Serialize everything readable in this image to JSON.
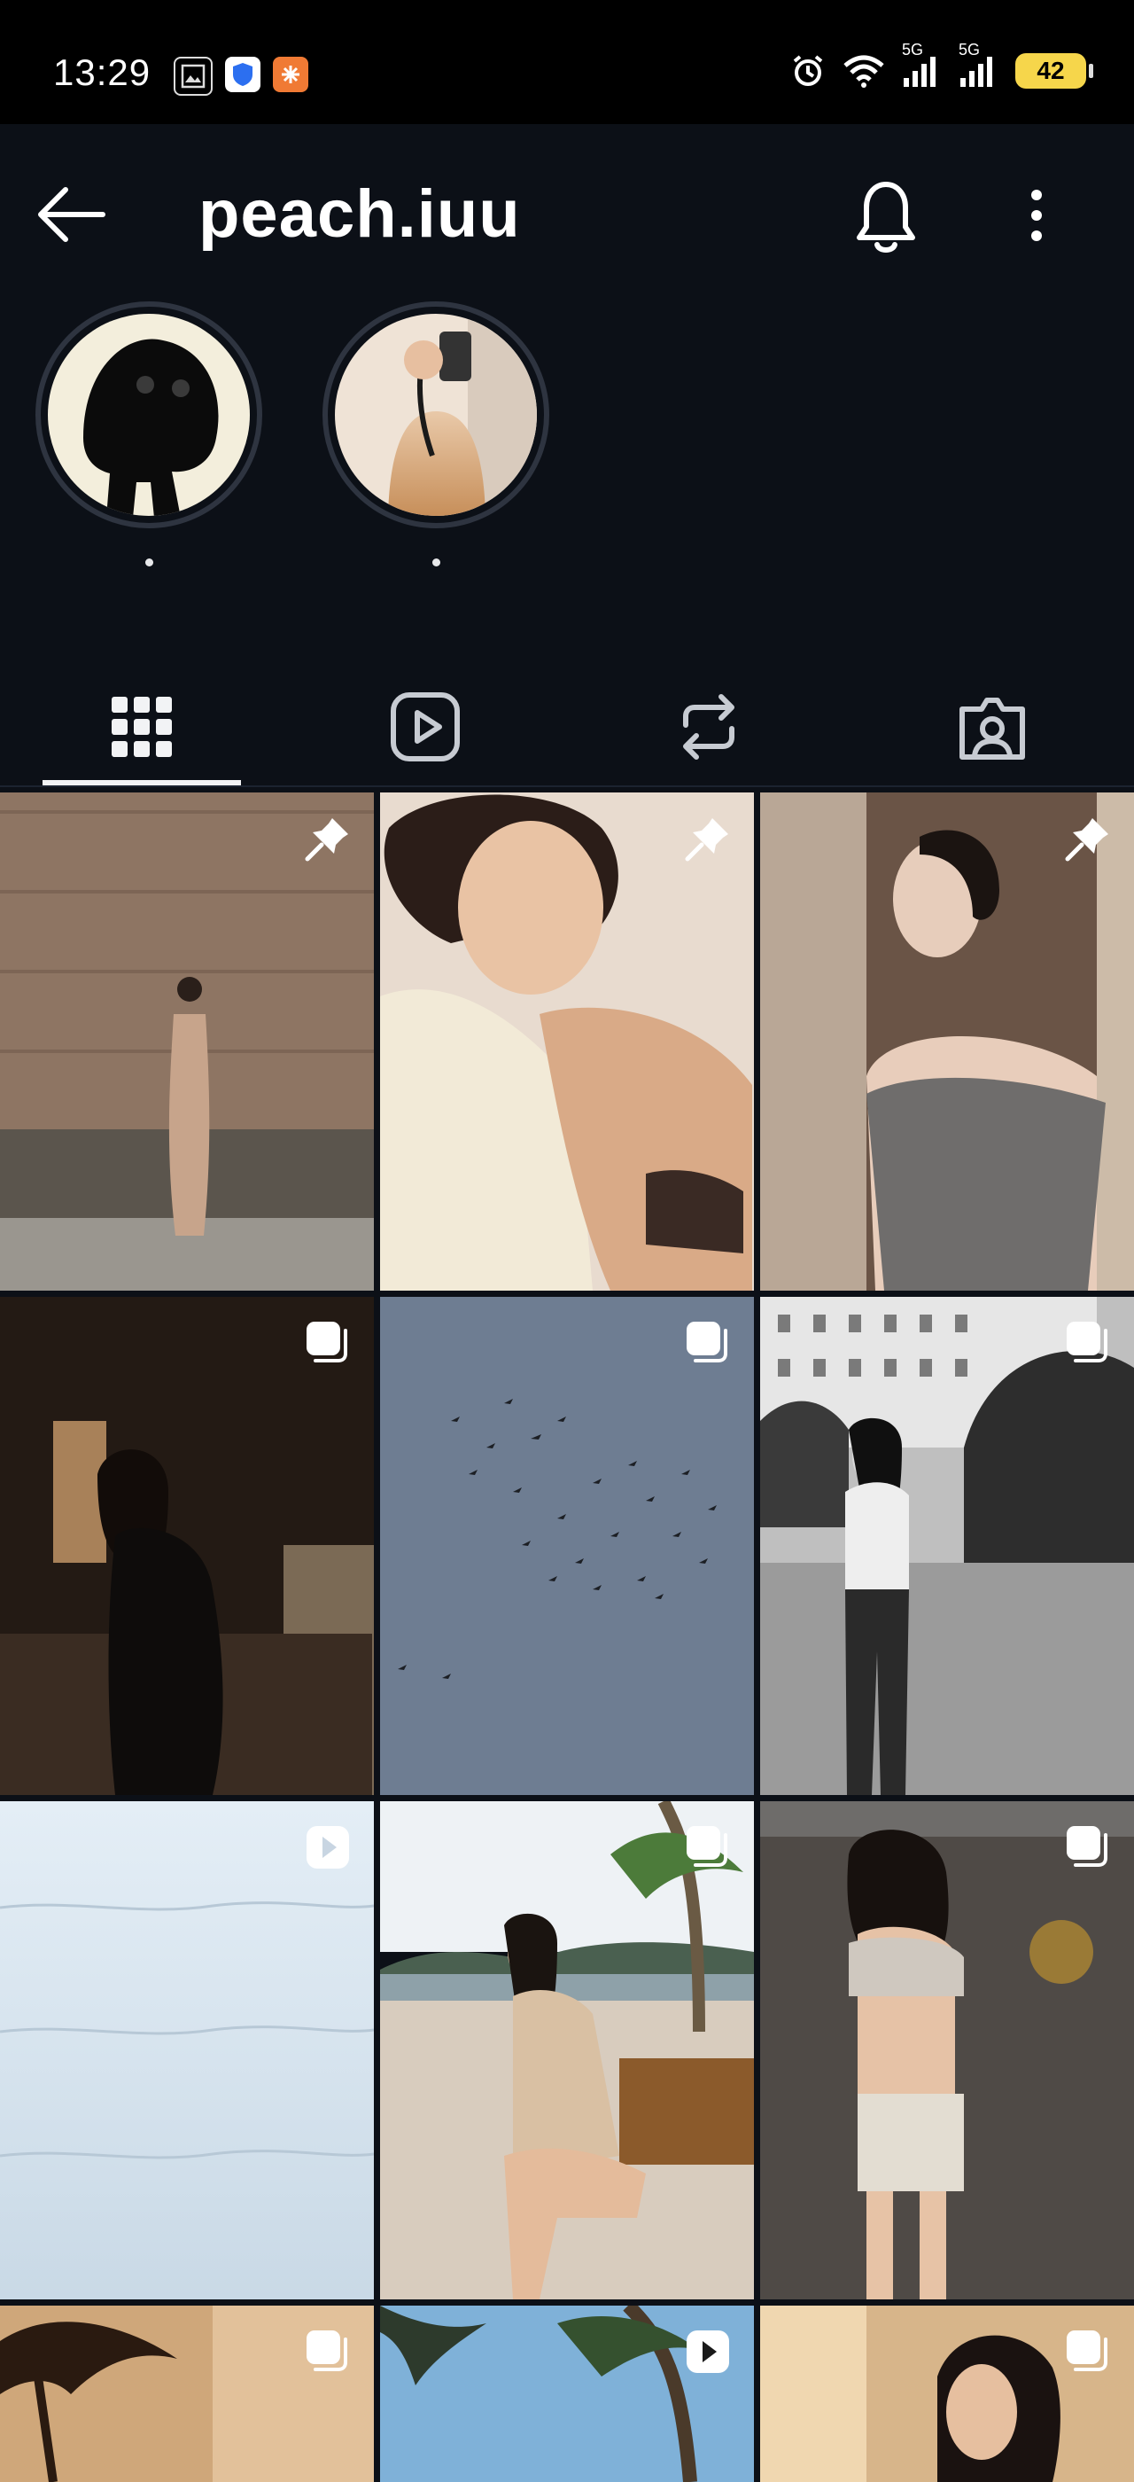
{
  "status_bar": {
    "time": "13:29",
    "signal_label_1": "5G",
    "signal_label_2": "5G",
    "battery": "42"
  },
  "header": {
    "username": "peach.iuu",
    "back_icon": "arrow-left-icon",
    "bell_icon": "bell-icon",
    "more_icon": "more-vertical-icon"
  },
  "stories": [
    {
      "name": "story-1"
    },
    {
      "name": "story-2"
    }
  ],
  "tabs": [
    {
      "name": "tab-posts",
      "icon": "grid-icon",
      "selected": true
    },
    {
      "name": "tab-reels",
      "icon": "reels-icon",
      "selected": false
    },
    {
      "name": "tab-reposts",
      "icon": "repost-icon",
      "selected": false
    },
    {
      "name": "tab-tagged",
      "icon": "tagged-person-icon",
      "selected": false
    }
  ],
  "grid": [
    {
      "overlay": "pin-icon"
    },
    {
      "overlay": "pin-icon"
    },
    {
      "overlay": "pin-icon"
    },
    {
      "overlay": "carousel-icon"
    },
    {
      "overlay": "carousel-icon"
    },
    {
      "overlay": "carousel-icon"
    },
    {
      "overlay": "reel-icon"
    },
    {
      "overlay": "carousel-icon"
    },
    {
      "overlay": "carousel-icon"
    },
    {
      "overlay": "carousel-icon"
    },
    {
      "overlay": "reel-icon"
    },
    {
      "overlay": "carousel-icon"
    }
  ],
  "colors": {
    "background": "#0c1017",
    "text": "#f2f3f5",
    "battery": "#f6d64b"
  }
}
